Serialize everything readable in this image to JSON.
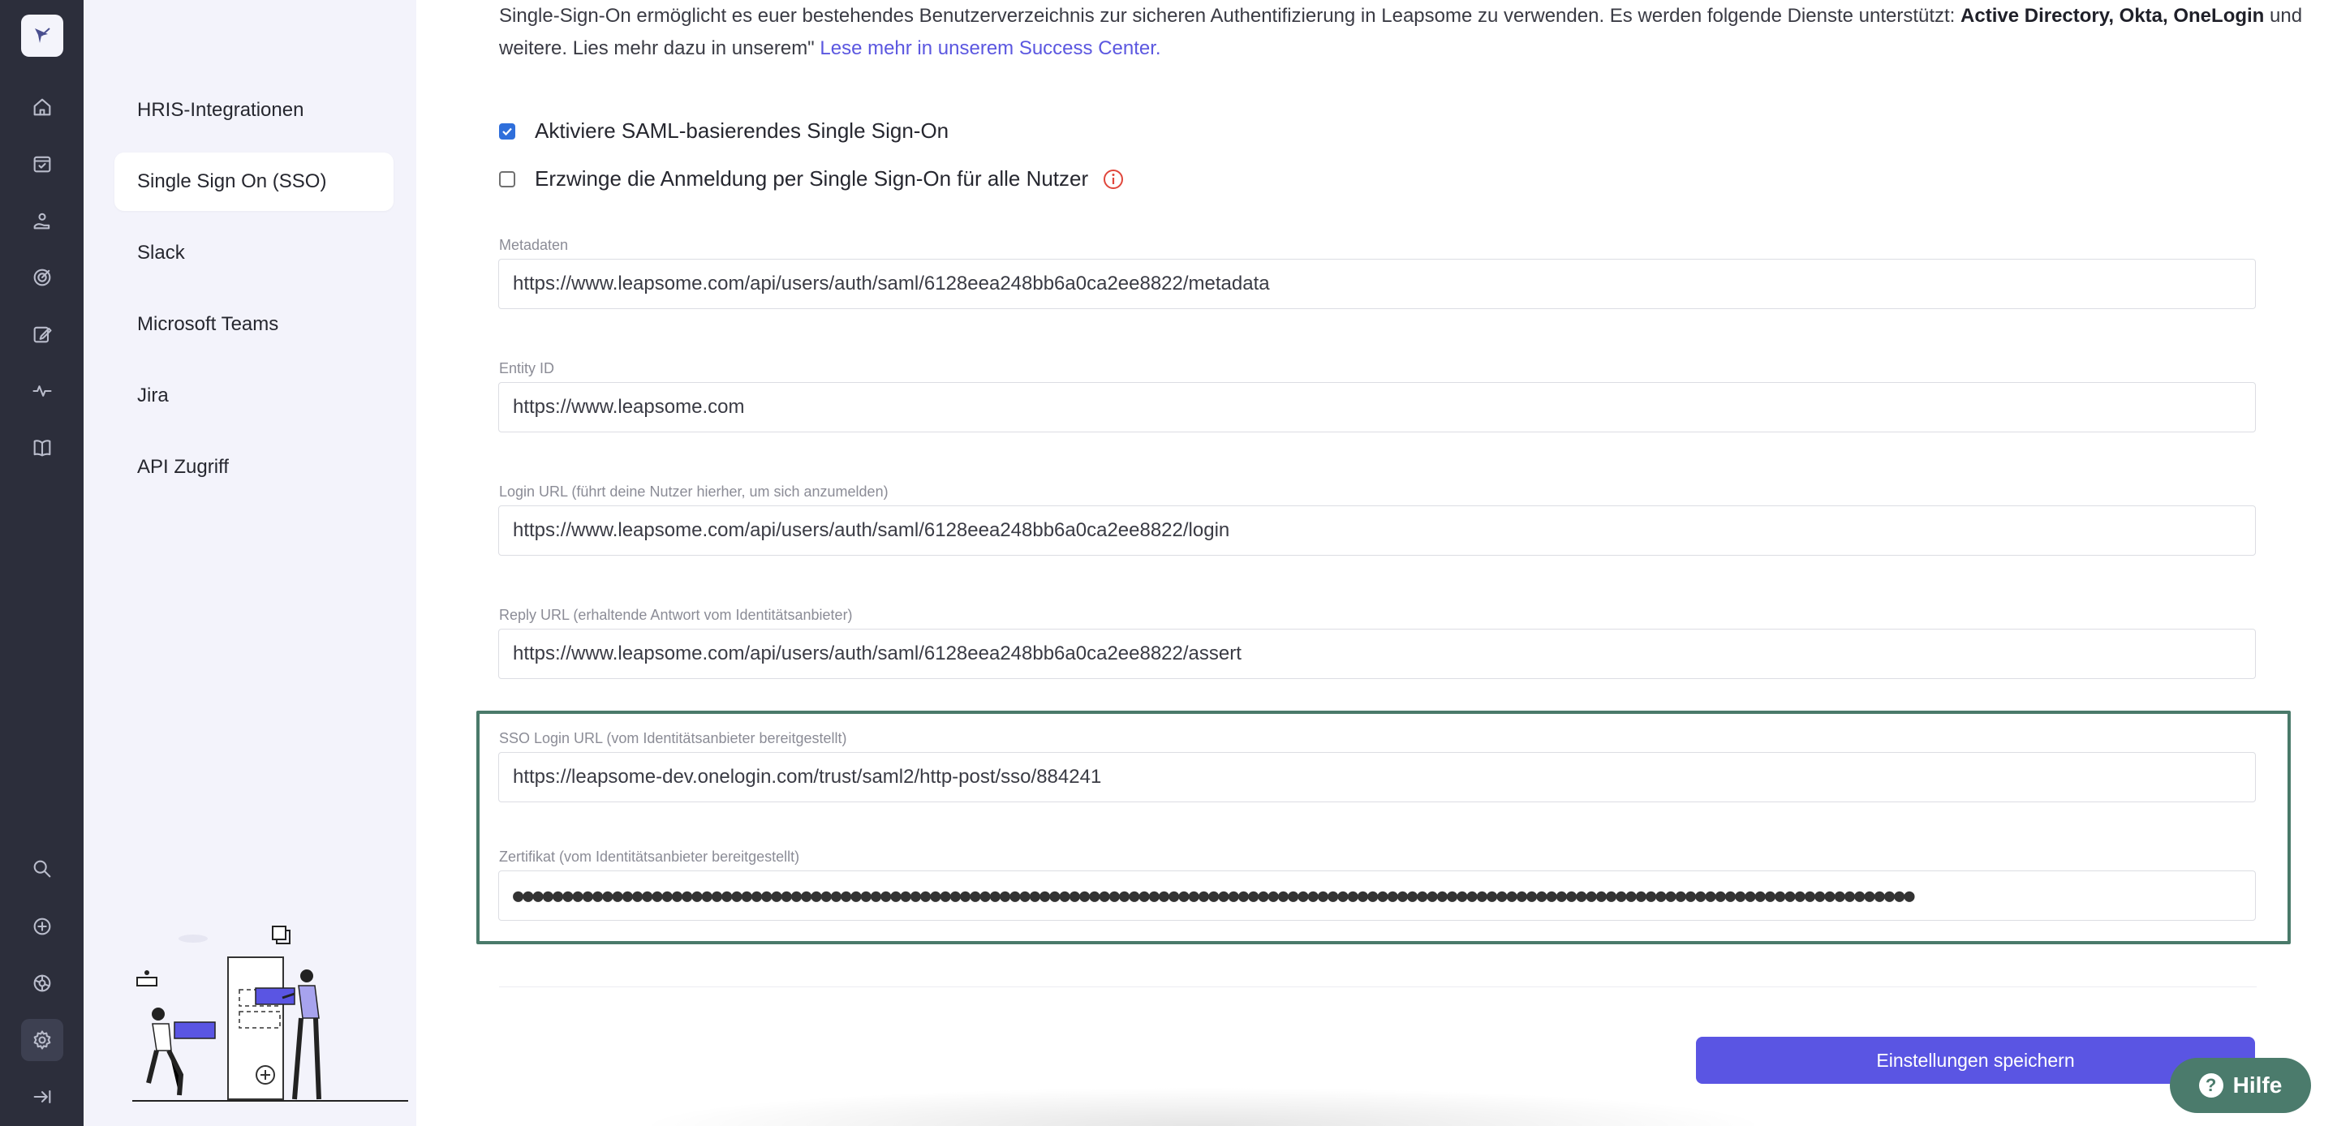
{
  "rail": {
    "logo_icon": "leapsome-bird-logo",
    "top_icons": [
      "home-icon",
      "calendar-check-icon",
      "user-hand-icon",
      "target-icon",
      "edit-icon",
      "pulse-icon",
      "book-icon"
    ],
    "bottom_icons": [
      "search-icon",
      "plus-circle-icon",
      "network-icon",
      "gear-icon",
      "collapse-icon"
    ],
    "active": "gear-icon"
  },
  "subnav": {
    "items": [
      {
        "label": "HRIS-Integrationen"
      },
      {
        "label": "Single Sign On (SSO)",
        "active": true
      },
      {
        "label": "Slack"
      },
      {
        "label": "Microsoft Teams"
      },
      {
        "label": "Jira"
      },
      {
        "label": "API Zugriff"
      }
    ]
  },
  "intro": {
    "text_before": "Single-Sign-On ermöglicht es euer bestehendes Benutzerverzeichnis zur sicheren Authentifizierung in Leapsome zu verwenden. Es werden folgende Dienste unterstützt: ",
    "services": "Active Directory, Okta, OneLogin",
    "text_after": " und weitere. Lies mehr dazu in unserem\" ",
    "link": "Lese mehr in unserem Success Center."
  },
  "options": {
    "enable_saml": {
      "label": "Aktiviere SAML-basierendes Single Sign-On",
      "checked": true
    },
    "enforce_sso": {
      "label": "Erzwinge die Anmeldung per Single Sign-On für alle Nutzer",
      "checked": false
    }
  },
  "fields": {
    "metadata": {
      "label": "Metadaten",
      "value": "https://www.leapsome.com/api/users/auth/saml/6128eea248bb6a0ca2ee8822/metadata"
    },
    "entity_id": {
      "label": "Entity ID",
      "value": "https://www.leapsome.com"
    },
    "login_url": {
      "label": "Login URL (führt deine Nutzer hierher, um sich anzumelden)",
      "value": "https://www.leapsome.com/api/users/auth/saml/6128eea248bb6a0ca2ee8822/login"
    },
    "reply_url": {
      "label": "Reply URL (erhaltende Antwort vom Identitätsanbieter)",
      "value": "https://www.leapsome.com/api/users/auth/saml/6128eea248bb6a0ca2ee8822/assert"
    },
    "sso_login_url": {
      "label": "SSO Login URL (vom Identitätsanbieter bereitgestellt)",
      "value": "https://leapsome-dev.onelogin.com/trust/saml2/http-post/sso/884241"
    },
    "certificate": {
      "label": "Zertifikat (vom Identitätsanbieter bereitgestellt)",
      "value": "●●●●●●●●●●●●●●●●●●●●●●●●●●●●●●●●●●●●●●●●●●●●●●●●●●●●●●●●●●●●●●●●●●●●●●●●●●●●●●●●●●●●●●●●●●●●●●●●●●●●●●●●●●●●●●●●●●●●●●●●●●●●●●●●●●●●●●●●●●●●●"
    }
  },
  "actions": {
    "save_label": "Einstellungen speichern",
    "help_label": "Hilfe",
    "help_glyph": "?"
  },
  "colors": {
    "accent": "#5a55e3",
    "highlight_border": "#4a7a6a",
    "help_button": "#4b7b6c",
    "rail": "#2c2e3b"
  }
}
